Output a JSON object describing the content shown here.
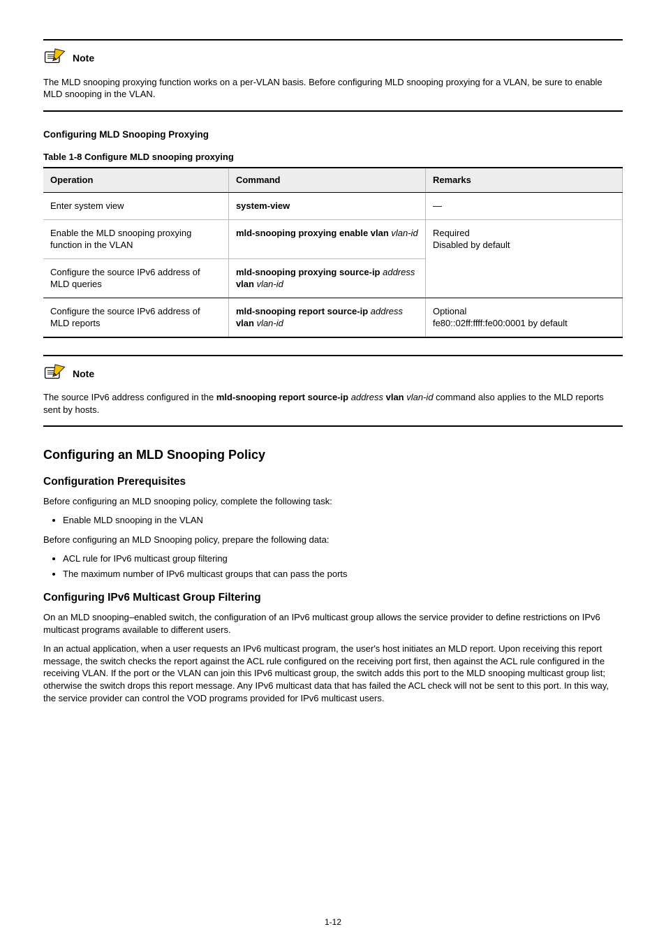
{
  "noteLabel": "Note",
  "note1": {
    "text": "The MLD snooping proxying function works on a per-VLAN basis. Before configuring MLD snooping proxying for a VLAN, be sure to enable MLD snooping in the VLAN."
  },
  "section": {
    "configuringHeading": "Configuring MLD Snooping Proxying",
    "tableCaption": "Table 1-8 Configure MLD snooping proxying",
    "headers": {
      "op": "Operation",
      "cmd": "Command",
      "rem": "Remarks"
    },
    "rows": [
      {
        "opText": "Enter system view",
        "cmd": [
          {
            "kw": "system-view"
          }
        ],
        "remText": "",
        "remDash": "—"
      },
      {
        "opText": "Enable the MLD snooping proxying function in the VLAN",
        "cmd": [
          {
            "kw": "mld-snooping proxying enable vlan"
          },
          {
            "arg": " vlan-id"
          }
        ],
        "remTextA": "Required",
        "remTextB": "Disabled by default"
      },
      {
        "opText": "Configure the source IPv6 address of MLD queries",
        "cmd": [
          {
            "kw": "mld-snooping proxying source-ip "
          },
          {
            "arg": "address"
          },
          {
            "kw": " vlan "
          },
          {
            "arg": "vlan-id"
          }
        ],
        "remText": ""
      },
      {
        "opText": "Configure the source IPv6 address of MLD reports",
        "cmd": [
          {
            "kw": "mld-snooping report source-ip"
          },
          {
            "arg": " address"
          },
          {
            "kw": " vlan "
          },
          {
            "arg": "vlan-id"
          }
        ],
        "remTextA": "Optional",
        "remTextB": "fe80::02ff:ffff:fe00:0001 by default"
      }
    ]
  },
  "note2": {
    "text": "The source IPv6 address configured in the mld-snooping report source-ip address vlan vlan-id command also applies to the MLD reports sent by hosts."
  },
  "lower": {
    "h2": "Configuring an MLD Snooping Policy",
    "h3a": "Configuration Prerequisites",
    "paraA": "Before configuring an MLD snooping policy, complete the following task:",
    "bulletA1": "Enable MLD snooping in the VLAN",
    "paraB": "Before configuring an MLD Snooping policy, prepare the following data:",
    "bulletB1": "ACL rule for IPv6 multicast group filtering",
    "bulletB2": "The maximum number of IPv6 multicast groups that can pass the ports",
    "h3b": "Configuring IPv6 Multicast Group Filtering",
    "paraC": "On an MLD snooping–enabled switch, the configuration of an IPv6 multicast group allows the service provider to define restrictions on IPv6 multicast programs available to different users.",
    "paraD1": "In an actual application, when a user requests an IPv6 multicast program, the user's host initiates an MLD report. Upon receiving this report message, the switch checks the report against the ACL rule configured on the receiving port first, then against the ACL rule configured in the receiving VLAN. If the port or the VLAN can join this IPv6 multicast group, the switch adds this port to the MLD snooping multicast group list; otherwise the switch drops this report message. Any IPv6 multicast data that has failed the ACL check will not be sent to this port. In this way, the service provider can control the VOD programs provided for IPv6 multicast users."
  },
  "pageNumber": "1-12"
}
